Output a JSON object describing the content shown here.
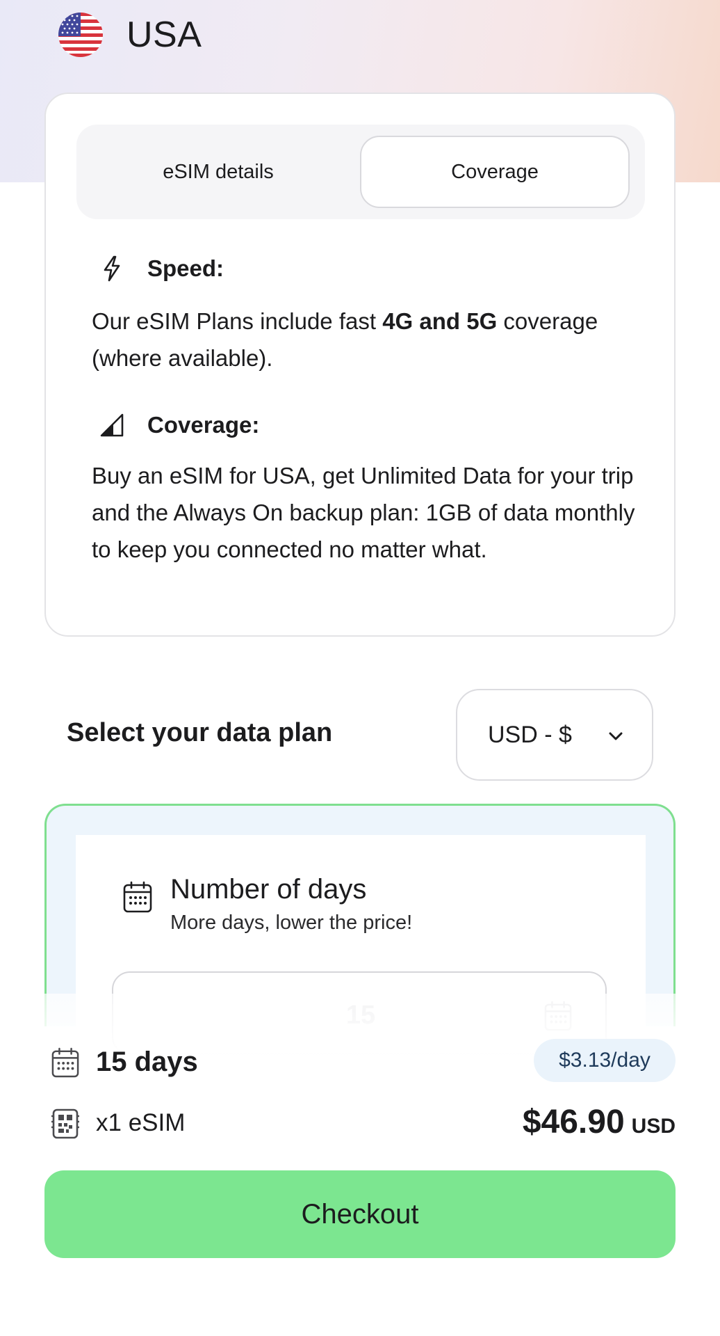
{
  "header": {
    "country": "USA",
    "flag_icon": "us-flag-icon"
  },
  "tabs": [
    {
      "label": "eSIM details",
      "active": false
    },
    {
      "label": "Coverage",
      "active": true
    }
  ],
  "features": {
    "speed": {
      "icon": "lightning-icon",
      "title": "Speed:",
      "text_before": "Our eSIM Plans include fast ",
      "text_bold": "4G and 5G",
      "text_after": " coverage (where available)."
    },
    "coverage": {
      "icon": "signal-icon",
      "title": "Coverage:",
      "text": "Buy an eSIM for USA, get Unlimited Data for your trip and the Always On backup plan: 1GB of data monthly to keep you connected no matter what."
    }
  },
  "plan": {
    "title": "Select your data plan",
    "currency": "USD - $",
    "days_title": "Number of days",
    "days_subtitle": "More days, lower the price!",
    "days_value": "15"
  },
  "summary": {
    "days": "15 days",
    "per_day": "$3.13/day",
    "esim": "x1 eSIM",
    "total": "$46.90",
    "total_currency": "USD"
  },
  "checkout": {
    "label": "Checkout"
  },
  "colors": {
    "accent_green": "#7ce690",
    "plan_border": "#7fdf8f",
    "text": "#1c1c1e"
  }
}
